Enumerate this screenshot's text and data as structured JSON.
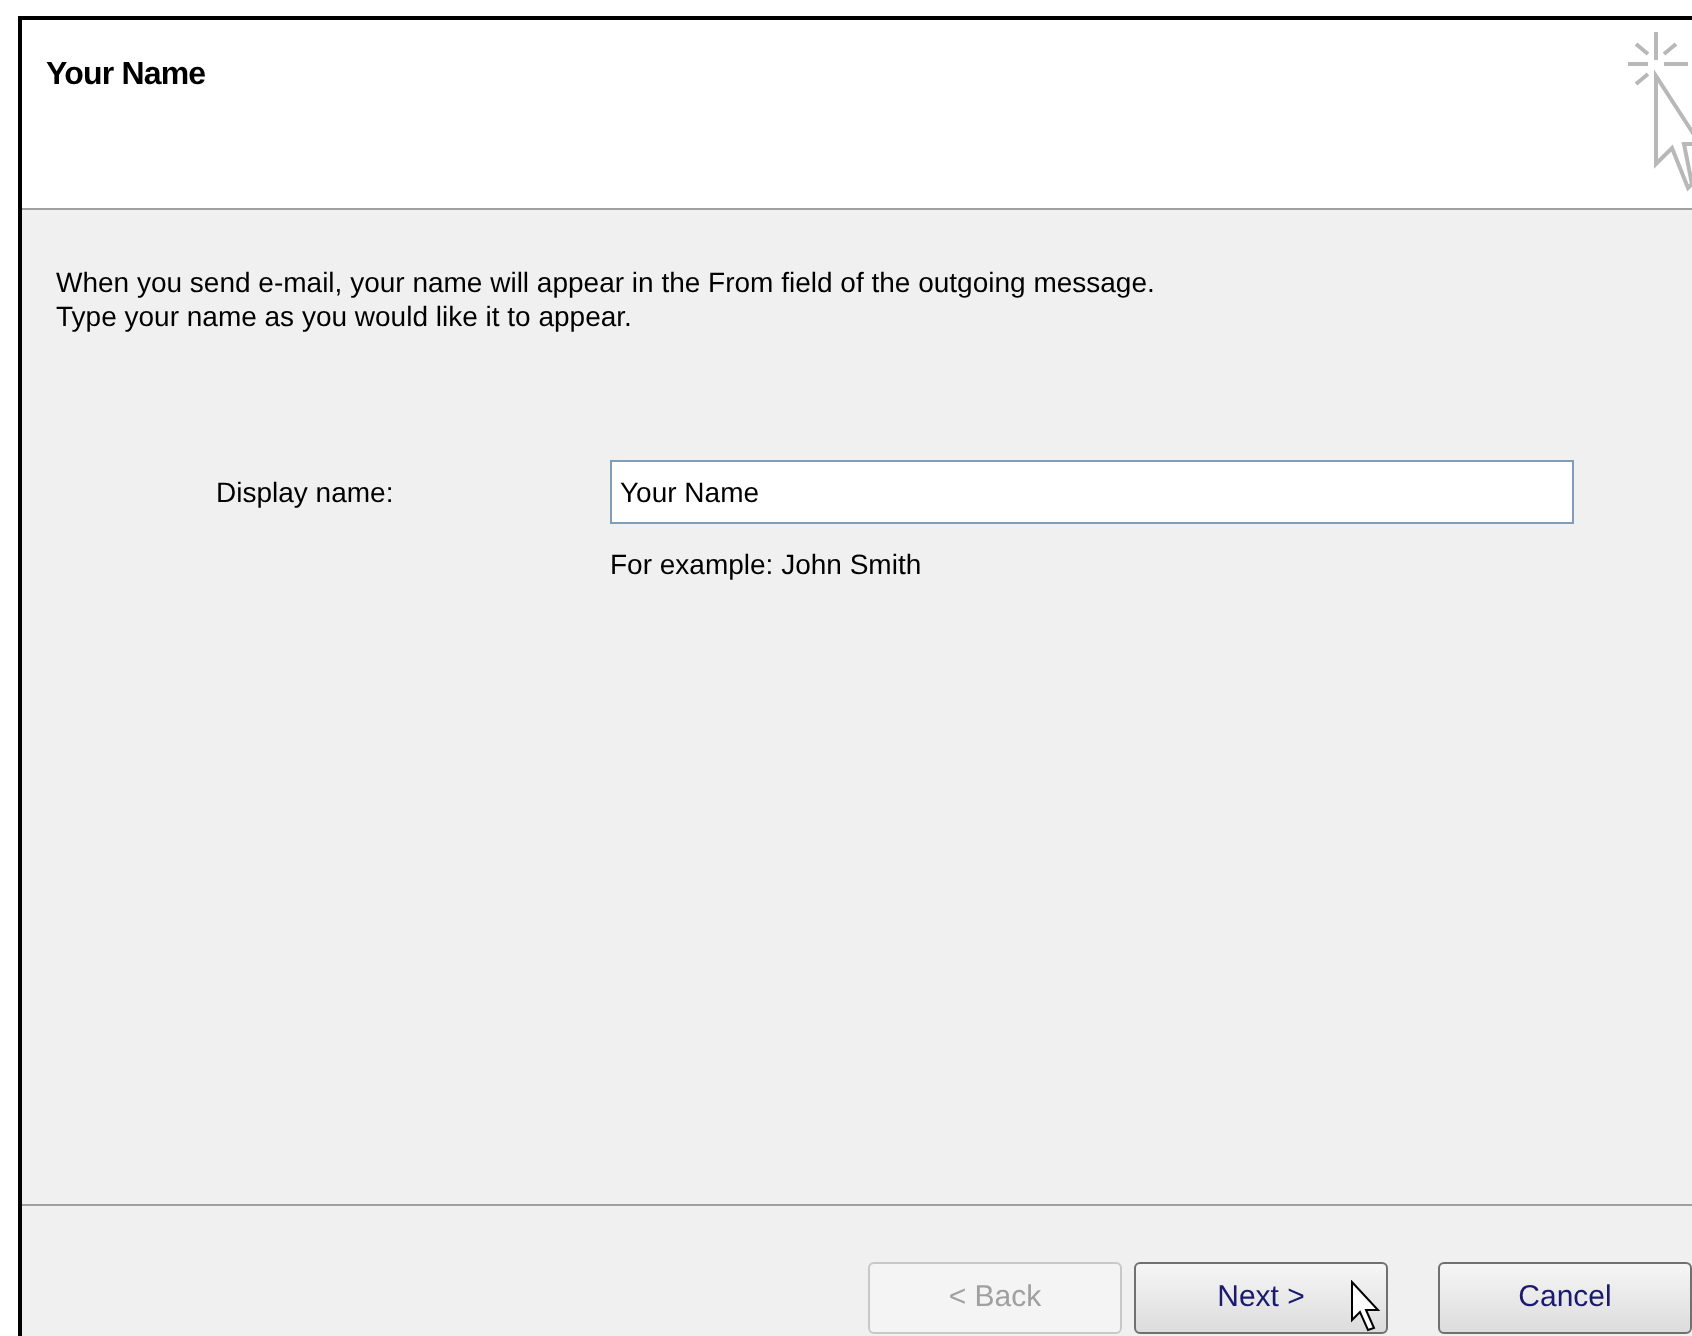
{
  "header": {
    "title": "Your Name"
  },
  "description": [
    "When you send e-mail, your name will appear in the From field of the outgoing message.",
    "Type your name as you would like it to appear."
  ],
  "display_name": {
    "label": "Display name:",
    "value": "Your Name",
    "hint": "For example: John Smith"
  },
  "buttons": [
    {
      "label": "< Back",
      "disabled": true
    },
    {
      "label": "Next >",
      "disabled": false
    },
    {
      "label": "Cancel",
      "disabled": false
    }
  ]
}
